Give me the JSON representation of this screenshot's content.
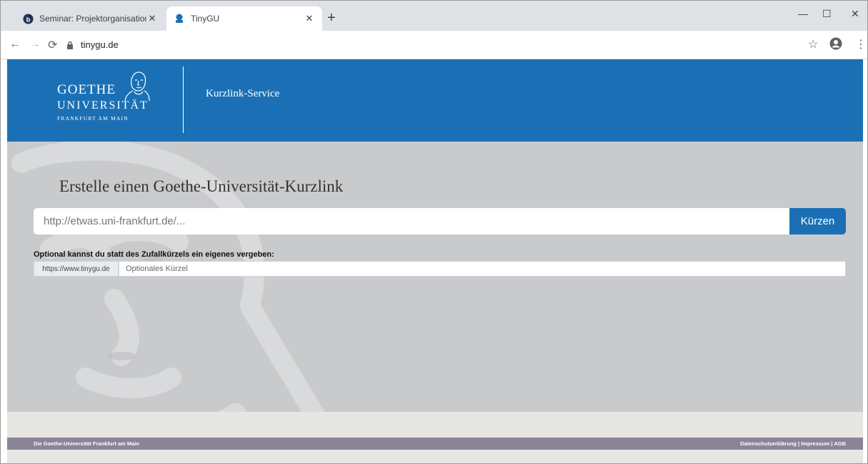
{
  "browser": {
    "tabs": [
      {
        "title": "Seminar: Projektorganisation",
        "icon": "blackboard-favicon-icon"
      },
      {
        "title": "TinyGU",
        "icon": "goethe-favicon-icon"
      }
    ],
    "url": "tinygu.de"
  },
  "header": {
    "logo_line1": "GOETHE",
    "logo_line2": "UNIVERSITÄT",
    "logo_line3": "FRANKFURT AM MAIN",
    "service_title": "Kurzlink-Service"
  },
  "main": {
    "headline": "Erstelle einen Goethe-Universität-Kurzlink",
    "url_placeholder": "http://etwas.uni-frankfurt.de/...",
    "shorten_label": "Kürzen",
    "optional_label": "Optional kannst du statt des Zufallkürzels ein eigenes vergeben:",
    "prefix": "https://www.tinygu.de",
    "alias_placeholder": "Optionales Kürzel"
  },
  "footer": {
    "left": "Die Goethe-Universität Frankfurt am Main",
    "privacy": "Datenschutzerklärung",
    "separator": " | ",
    "imprint": "Impressum",
    "terms": "AGB"
  },
  "colors": {
    "brand_blue": "#1b70b5",
    "page_gray": "#c9cacc",
    "footer_purple": "#8b8396"
  }
}
